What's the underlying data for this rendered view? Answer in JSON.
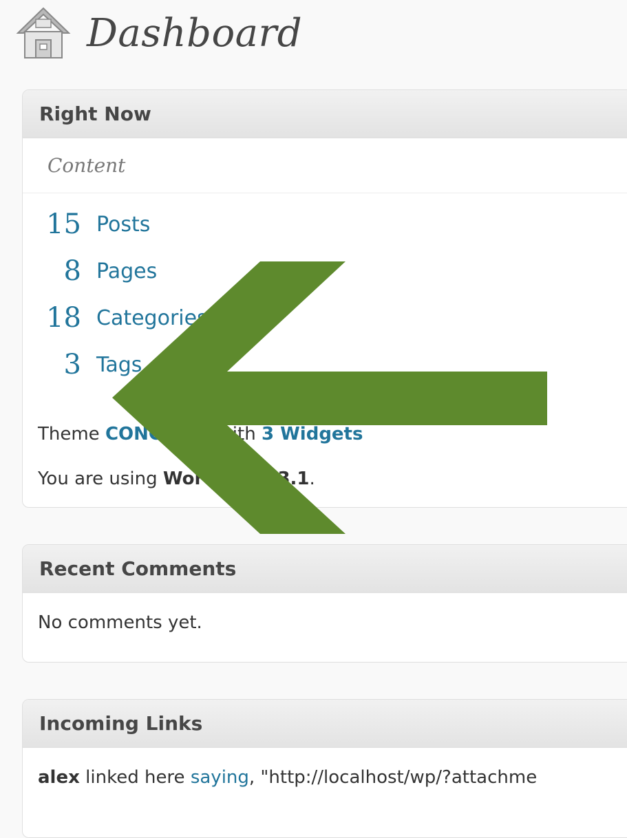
{
  "page": {
    "title": "Dashboard"
  },
  "right_now": {
    "title": "Right Now",
    "content_label": "Content",
    "items": [
      {
        "count": "15",
        "label": "Posts"
      },
      {
        "count": "8",
        "label": "Pages"
      },
      {
        "count": "18",
        "label": "Categories"
      },
      {
        "count": "3",
        "label": "Tags"
      }
    ],
    "theme_prefix": "Theme",
    "theme_name": "CONCRETE",
    "theme_with": "with",
    "widgets": "3 Widgets",
    "version_prefix": "You are using",
    "version_name": "WordPress 3.1",
    "version_suffix": "."
  },
  "recent_comments": {
    "title": "Recent Comments",
    "message": "No comments yet."
  },
  "incoming_links": {
    "title": "Incoming Links",
    "author": "alex",
    "text": "linked here",
    "link": "saying",
    "quote": ", \"http://localhost/wp/?attachme"
  },
  "overlay": {
    "arrow_icon": "left-arrow-icon",
    "color": "#5e8a2d"
  }
}
